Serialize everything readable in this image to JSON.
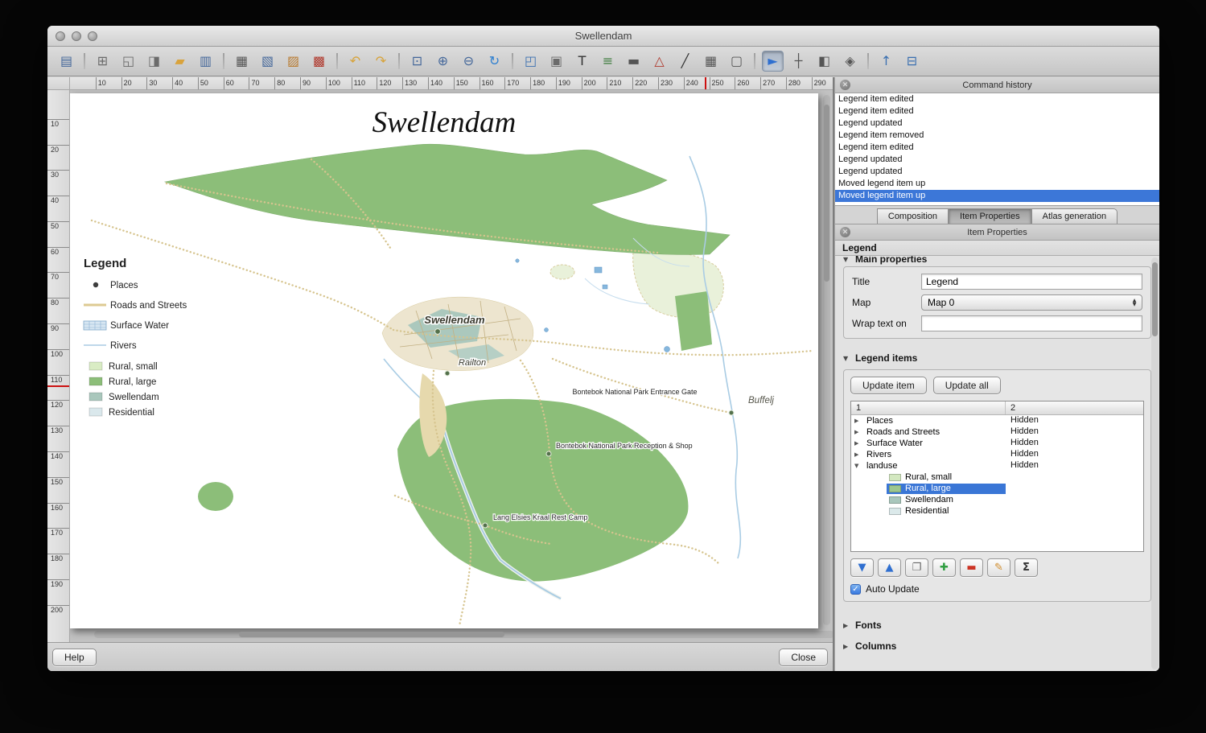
{
  "window": {
    "title": "Swellendam"
  },
  "toolbar": {
    "items": [
      {
        "name": "save-project-button",
        "glyph": "▤",
        "color": "#44679a"
      },
      {
        "type": "sep",
        "name": "toolbar-separator"
      },
      {
        "name": "new-composer-button",
        "glyph": "⊞",
        "color": "#6b6b6b"
      },
      {
        "name": "duplicate-composer-button",
        "glyph": "◱",
        "color": "#6b6b6b"
      },
      {
        "name": "composer-manager-button",
        "glyph": "◨",
        "color": "#6b6b6b"
      },
      {
        "name": "load-from-template-button",
        "glyph": "▰",
        "color": "#d9a33c"
      },
      {
        "name": "save-as-template-button",
        "glyph": "▥",
        "color": "#44679a"
      },
      {
        "type": "sep",
        "name": "toolbar-separator"
      },
      {
        "name": "print-button",
        "glyph": "▦",
        "color": "#555555"
      },
      {
        "name": "export-image-button",
        "glyph": "▧",
        "color": "#44679a"
      },
      {
        "name": "export-svg-button",
        "glyph": "▨",
        "color": "#b87a2e"
      },
      {
        "name": "export-pdf-button",
        "glyph": "▩",
        "color": "#b03a2e"
      },
      {
        "type": "sep",
        "name": "toolbar-separator"
      },
      {
        "name": "undo-button",
        "glyph": "↶",
        "color": "#d7a33a"
      },
      {
        "name": "redo-button",
        "glyph": "↷",
        "color": "#d7a33a"
      },
      {
        "type": "sep",
        "name": "toolbar-separator"
      },
      {
        "name": "zoom-full-button",
        "glyph": "⊡",
        "color": "#44679a"
      },
      {
        "name": "zoom-in-button",
        "glyph": "⊕",
        "color": "#44679a"
      },
      {
        "name": "zoom-out-button",
        "glyph": "⊖",
        "color": "#44679a"
      },
      {
        "name": "refresh-view-button",
        "glyph": "↻",
        "color": "#2e7fd0"
      },
      {
        "type": "sep",
        "name": "toolbar-separator"
      },
      {
        "name": "add-map-button",
        "glyph": "◰",
        "color": "#3a6fb0"
      },
      {
        "name": "add-image-button",
        "glyph": "▣",
        "color": "#6b6b6b"
      },
      {
        "name": "add-label-button",
        "glyph": "T",
        "color": "#333333"
      },
      {
        "name": "add-legend-button",
        "glyph": "≡",
        "color": "#3a7a3a"
      },
      {
        "name": "add-scalebar-button",
        "glyph": "▬",
        "color": "#555555"
      },
      {
        "name": "add-shape-button",
        "glyph": "△",
        "color": "#b03a2e"
      },
      {
        "name": "add-arrow-button",
        "glyph": "╱",
        "color": "#333333"
      },
      {
        "name": "add-attribute-table-button",
        "glyph": "▦",
        "color": "#555555"
      },
      {
        "name": "add-html-frame-button",
        "glyph": "▢",
        "color": "#555555"
      },
      {
        "type": "sep",
        "name": "toolbar-separator"
      },
      {
        "name": "select-move-item-button",
        "glyph": "►",
        "color": "#2e6fd0",
        "active": true
      },
      {
        "name": "move-item-content-button",
        "glyph": "┼",
        "color": "#555555"
      },
      {
        "name": "group-items-button",
        "glyph": "◧",
        "color": "#555555"
      },
      {
        "name": "lock-items-button",
        "glyph": "◈",
        "color": "#555555"
      },
      {
        "type": "sep",
        "name": "toolbar-separator"
      },
      {
        "name": "raise-items-button",
        "glyph": "↑",
        "color": "#3a6fb0"
      },
      {
        "name": "align-items-button",
        "glyph": "⊟",
        "color": "#3a6fb0"
      }
    ]
  },
  "rulers": {
    "horizontal": [
      "10",
      "20",
      "30",
      "40",
      "50",
      "60",
      "70",
      "80",
      "90",
      "100",
      "110",
      "120",
      "130",
      "140",
      "150",
      "160",
      "170",
      "180",
      "190",
      "200",
      "210",
      "220",
      "230",
      "240",
      "250",
      "260",
      "270",
      "280",
      "290"
    ],
    "vertical": [
      "10",
      "20",
      "30",
      "40",
      "50",
      "60",
      "70",
      "80",
      "90",
      "100",
      "110",
      "120",
      "130",
      "140",
      "150",
      "160",
      "170",
      "180",
      "190",
      "200"
    ]
  },
  "canvas": {
    "map_title": "Swellendam",
    "legend": {
      "title": "Legend",
      "items": [
        "Places",
        "Roads and Streets",
        "Surface Water",
        "Rivers",
        "Rural, small",
        "Rural, large",
        "Swellendam",
        "Residential"
      ]
    },
    "labels": {
      "town": "Swellendam",
      "railton": "Railton",
      "entrance_gate": "Bontebok National Park Entrance Gate",
      "buffel": "Buffelj",
      "reception": "Bontebok National Park Reception & Shop",
      "rest_camp": "Lang Elsies Kraal Rest Camp"
    },
    "colors": {
      "rural_large": "#8cbe79",
      "rural_small": "#e9f1da",
      "swellendam_landuse": "#abc8bd",
      "residential": "#dae8ec",
      "river": "#a9cce4",
      "road": "#d6c48e"
    }
  },
  "command_history": {
    "title": "Command history",
    "items": [
      {
        "label": "Legend item edited"
      },
      {
        "label": "Legend item edited"
      },
      {
        "label": "Legend updated"
      },
      {
        "label": "Legend item removed"
      },
      {
        "label": "Legend item edited"
      },
      {
        "label": "Legend updated"
      },
      {
        "label": "Legend updated"
      },
      {
        "label": "Moved legend item up"
      },
      {
        "label": "Moved legend item up",
        "selected": true
      }
    ]
  },
  "tabs": [
    {
      "label": "Composition",
      "name": "tab-composition"
    },
    {
      "label": "Item Properties",
      "name": "tab-item-properties",
      "active": true
    },
    {
      "label": "Atlas generation",
      "name": "tab-atlas-generation"
    }
  ],
  "item_properties": {
    "panel_title": "Item Properties",
    "item_type": "Legend",
    "main_properties": {
      "section_label": "Main properties",
      "title_label": "Title",
      "title_value": "Legend",
      "map_label": "Map",
      "map_value": "Map 0",
      "wrap_label": "Wrap text on",
      "wrap_value": ""
    },
    "legend_items": {
      "section_label": "Legend items",
      "update_item_button": "Update item",
      "update_all_button": "Update all",
      "columns": [
        "1",
        "2"
      ],
      "rows": [
        {
          "label": "Places",
          "col2": "Hidden",
          "arrow": "right",
          "name": "tree-row-places"
        },
        {
          "label": "Roads and Streets",
          "col2": "Hidden",
          "arrow": "right",
          "name": "tree-row-roads-and-streets"
        },
        {
          "label": "Surface Water",
          "col2": "Hidden",
          "arrow": "right",
          "name": "tree-row-surface-water"
        },
        {
          "label": "Rivers",
          "col2": "Hidden",
          "arrow": "right",
          "name": "tree-row-rivers"
        },
        {
          "label": "landuse",
          "col2": "Hidden",
          "arrow": "down",
          "name": "tree-row-landuse"
        },
        {
          "label": "Rural, small",
          "swatch": "#d3e8c0",
          "child": true,
          "name": "tree-row-rural-small"
        },
        {
          "label": "Rural, large",
          "swatch": "#9dc78f",
          "child": true,
          "selected": true,
          "name": "tree-row-rural-large"
        },
        {
          "label": "Swellendam",
          "swatch": "#a9c7bc",
          "child": true,
          "name": "tree-row-swellendam"
        },
        {
          "label": "Residential",
          "swatch": "#dbe9ea",
          "child": true,
          "name": "tree-row-residential"
        }
      ],
      "tools": [
        {
          "name": "move-item-down-button",
          "glyph": "▼",
          "cls": "tool-blue"
        },
        {
          "name": "move-item-up-button",
          "glyph": "▲",
          "cls": "tool-blue"
        },
        {
          "name": "paste-item-button",
          "glyph": "❐",
          "cls": "tool-gray"
        },
        {
          "name": "add-item-button",
          "glyph": "✚",
          "cls": "tool-green"
        },
        {
          "name": "remove-item-button",
          "glyph": "▬",
          "cls": "tool-red"
        },
        {
          "name": "edit-item-button",
          "glyph": "✎",
          "cls": "tool-orange"
        },
        {
          "name": "count-features-button",
          "glyph": "Σ",
          "cls": "tool-dark"
        }
      ],
      "auto_update_label": "Auto Update",
      "auto_update_checked": true
    },
    "collapsed_sections": [
      {
        "label": "Fonts",
        "name": "section-fonts"
      },
      {
        "label": "Columns",
        "name": "section-columns"
      }
    ],
    "selection_color": "#3a76d6"
  },
  "footer": {
    "help_button": "Help",
    "close_button": "Close"
  }
}
